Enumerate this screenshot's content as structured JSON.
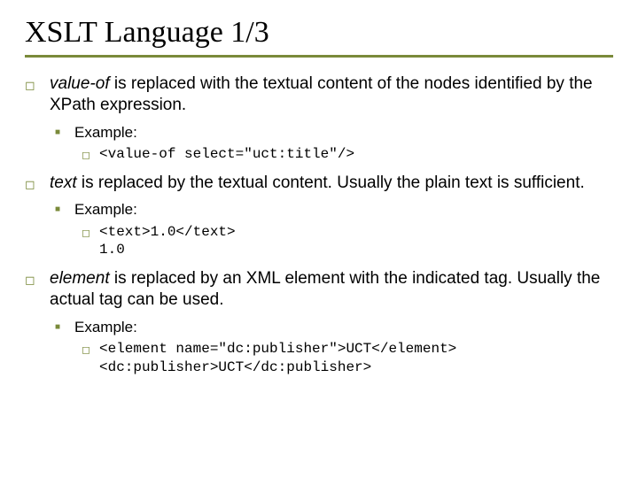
{
  "title": "XSLT Language 1/3",
  "items": [
    {
      "term": "value-of",
      "rest": " is replaced with the textual content of the nodes identified by the XPath expression.",
      "example_label": "Example:",
      "code": "<value-of select=\"uct:title\"/>"
    },
    {
      "term": "text",
      "rest": " is replaced by the textual content. Usually the plain text is sufficient.",
      "example_label": "Example:",
      "code": "<text>1.0</text>\n1.0"
    },
    {
      "term": "element",
      "rest": " is replaced by an XML element with the indicated tag. Usually the actual tag can be used.",
      "example_label": "Example:",
      "code": "<element name=\"dc:publisher\">UCT</element>\n<dc:publisher>UCT</dc:publisher>"
    }
  ]
}
